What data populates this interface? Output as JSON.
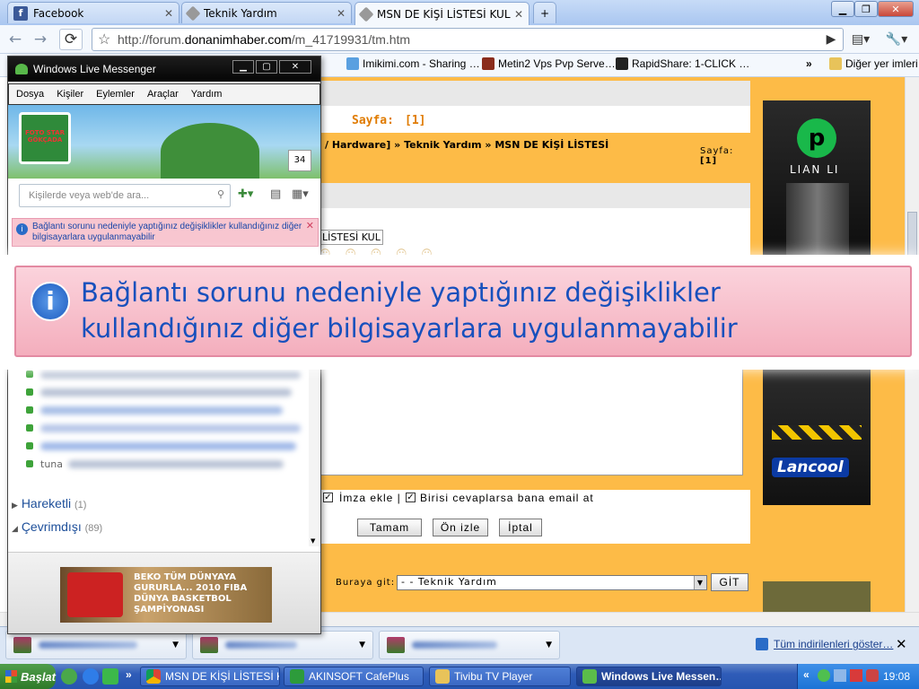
{
  "browser": {
    "tabs": [
      {
        "label": "Facebook",
        "icon": "facebook-icon"
      },
      {
        "label": "Teknik Yardım",
        "icon": "page-icon"
      },
      {
        "label": "MSN DE KİŞİ LİSTESİ KULL…",
        "icon": "page-icon"
      }
    ],
    "new_tab": "+",
    "url_prefix": "http://forum.",
    "url_domain": "donanimhaber.com",
    "url_path": "/m_41719931/tm.htm",
    "bookmarks": [
      {
        "label": "Imikimi.com - Sharing …",
        "icon": "imikimi-icon"
      },
      {
        "label": "Metin2 Vps Pvp Serve…",
        "icon": "metin2-icon"
      },
      {
        "label": "RapidShare: 1-CLICK …",
        "icon": "rapidshare-icon"
      }
    ],
    "bookmarks_overflow": "»",
    "other_bookmarks": "Diğer yer imleri"
  },
  "forum": {
    "page_label": "Sayfa:",
    "page_value": "[1]",
    "breadcrumb_part1": "/ Hardware]",
    "breadcrumb_sep": "»",
    "breadcrumb_part2": "Teknik Yardım",
    "breadcrumb_part3": "MSN DE KİŞİ LİSTESİ",
    "page_label_small": "Sayfa:",
    "page_value_small": "[1]",
    "title_fragment": "LİSTESİ KUL",
    "signature_label": "İmza ekle |",
    "notify_label": "Birisi cevaplarsa bana email at",
    "btn_ok": "Tamam",
    "btn_preview": "Ön izle",
    "btn_cancel": "İptal",
    "goto_label": "Buraya git:",
    "goto_value": "- - Teknik Yardım",
    "goto_button": "GİT",
    "ad1_brand": "LIAN LI",
    "ad2_brand": "Lancool"
  },
  "messenger": {
    "title": "Windows Live Messenger",
    "menu": [
      "Dosya",
      "Kişiler",
      "Eylemler",
      "Araçlar",
      "Yardım"
    ],
    "banner_logo": "FOTO STAR GÖKÇADA",
    "badge_count": "34",
    "search_placeholder": "Kişilerde veya web'de ara...",
    "notice": "Bağlantı sorunu nedeniyle yaptığınız değişiklikler kullandığınız diğer bilgisayarlara uygulanmayabilir",
    "group_mobile": "Hareketli",
    "group_mobile_count": "(1)",
    "group_offline": "Çevrimdışı",
    "group_offline_count": "(89)",
    "contact_visible": "tuna",
    "ad_text": "BEKO TÜM DÜNYAYA GURURLA... 2010 FIBA DÜNYA BASKETBOL ŞAMPİYONASI"
  },
  "zoom_notice": {
    "line1": "Bağlantı sorunu nedeniyle yaptığınız değişiklikler",
    "line2": "kullandığınız diğer bilgisayarlara uygulanmayabilir"
  },
  "downloads": {
    "show_all": "Tüm indirilenleri göster…"
  },
  "taskbar": {
    "start": "Başlat",
    "items": [
      {
        "label": "MSN DE KİŞİ LİSTESİ KU…"
      },
      {
        "label": "AKINSOFT CafePlus"
      },
      {
        "label": "Tivibu TV Player"
      },
      {
        "label": "Windows Live Messen…"
      }
    ],
    "clock": "19:08"
  },
  "colors": {
    "forum_orange": "#fdbb47",
    "notice_pink": "#f8c6d0",
    "notice_text": "#1750bd",
    "taskbar_blue": "#2555b0"
  }
}
